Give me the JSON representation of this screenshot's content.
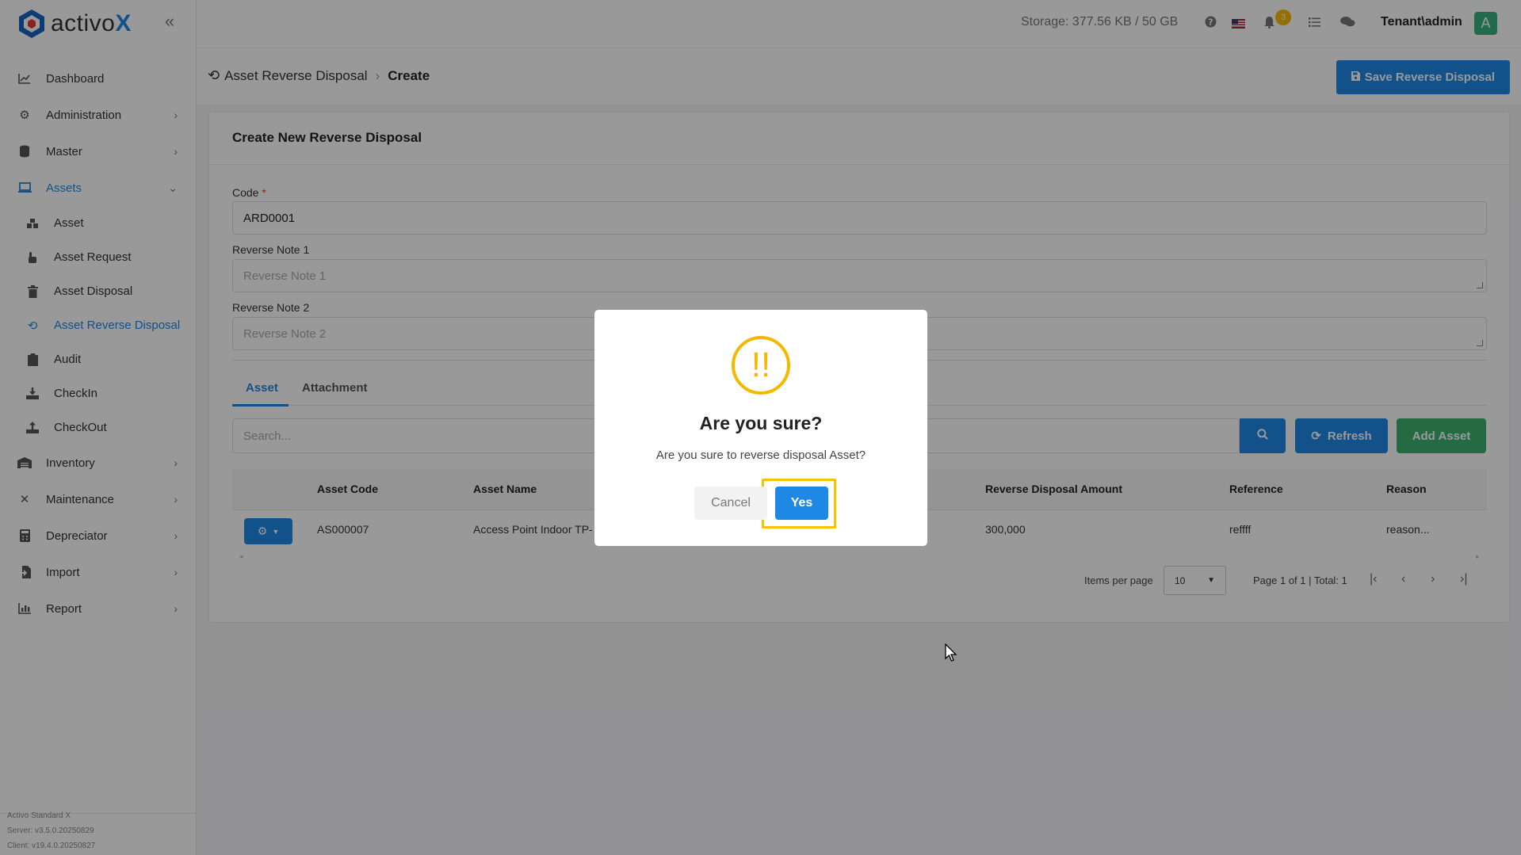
{
  "app": {
    "logo_text_a": "activo",
    "logo_text_b": "X",
    "version_lines": [
      "Activo Standard X",
      "Server: v3.5.0.20250829",
      "Client: v19.4.0.20250827"
    ]
  },
  "sidebar": {
    "items": [
      {
        "label": "Dashboard",
        "icon": "chart-line-icon"
      },
      {
        "label": "Administration",
        "icon": "gears-icon"
      },
      {
        "label": "Master",
        "icon": "database-icon"
      },
      {
        "label": "Assets",
        "icon": "laptop-icon"
      },
      {
        "label": "Asset",
        "icon": "boxes-icon"
      },
      {
        "label": "Asset Request",
        "icon": "hand-icon"
      },
      {
        "label": "Asset Disposal",
        "icon": "trash-icon"
      },
      {
        "label": "Asset Reverse Disposal",
        "icon": "undo-icon"
      },
      {
        "label": "Audit",
        "icon": "clipboard-icon"
      },
      {
        "label": "CheckIn",
        "icon": "download-icon"
      },
      {
        "label": "CheckOut",
        "icon": "upload-icon"
      },
      {
        "label": "Inventory",
        "icon": "warehouse-icon"
      },
      {
        "label": "Maintenance",
        "icon": "tools-icon"
      },
      {
        "label": "Depreciator",
        "icon": "calculator-icon"
      },
      {
        "label": "Import",
        "icon": "file-import-icon"
      },
      {
        "label": "Report",
        "icon": "chart-bar-icon"
      }
    ]
  },
  "topbar": {
    "storage": "Storage: 377.56 KB / 50 GB",
    "notification_count": "3",
    "user": "Tenant\\admin",
    "avatar_letter": "A"
  },
  "header": {
    "breadcrumb_parent": "Asset Reverse Disposal",
    "breadcrumb_current": "Create",
    "save_label": "Save Reverse Disposal"
  },
  "form": {
    "title": "Create New Reverse Disposal",
    "code_label": "Code",
    "code_required": "*",
    "code_value": "ARD0001",
    "note1_label": "Reverse Note 1",
    "note1_placeholder": "Reverse Note 1",
    "note2_label": "Reverse Note 2",
    "note2_placeholder": "Reverse Note 2"
  },
  "tabs": [
    {
      "label": "Asset"
    },
    {
      "label": "Attachment"
    }
  ],
  "toolbar": {
    "search_placeholder": "Search...",
    "refresh_label": "Refresh",
    "add_label": "Add Asset"
  },
  "table": {
    "columns": [
      "Asset Code",
      "Asset Name",
      "Reverse Disposal Amount",
      "Reference",
      "Reason"
    ],
    "rows": [
      {
        "code": "AS000007",
        "name": "Access Point Indoor TP-",
        "amount": "300,000",
        "reference": "reffff",
        "reason": "reason..."
      }
    ]
  },
  "pagination": {
    "items_per_page_label": "Items per page",
    "items_per_page": "10",
    "summary": "Page 1 of 1 | Total: 1"
  },
  "dialog": {
    "icon_glyph": "!!",
    "title": "Are you sure?",
    "message": "Are you sure to reverse disposal Asset?",
    "cancel_label": "Cancel",
    "yes_label": "Yes"
  },
  "colors": {
    "primary": "#1e88e5",
    "success": "#3cb371",
    "warning": "#f5b800"
  }
}
